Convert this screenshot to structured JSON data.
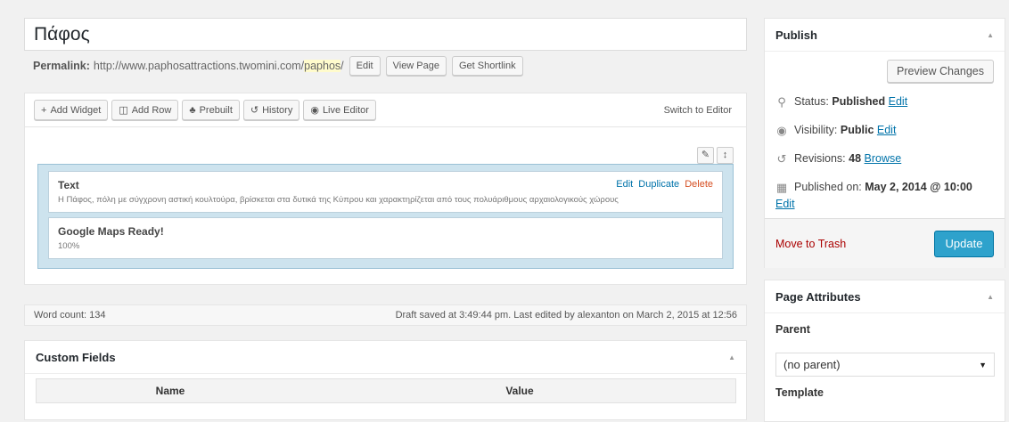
{
  "title": "Πάφος",
  "permalink": {
    "label": "Permalink:",
    "base": "http://www.paphosattractions.twomini.com/",
    "slug": "paphos",
    "slash": "/",
    "edit": "Edit",
    "view": "View Page",
    "shortlink": "Get Shortlink"
  },
  "builder": {
    "add_widget": "Add Widget",
    "add_row": "Add Row",
    "prebuilt": "Prebuilt",
    "history": "History",
    "live_editor": "Live Editor",
    "switch": "Switch to Editor",
    "widgets": [
      {
        "title": "Text",
        "desc": "Η Πάφος, πόλη με σύγχρονη αστική κουλτούρα, βρίσκεται στα δυτικά της Κύπρου και χαρακτηρίζεται από τους πολυάριθμους αρχαιολογικούς χώρους",
        "edit": "Edit",
        "duplicate": "Duplicate",
        "delete": "Delete"
      },
      {
        "title": "Google Maps Ready!",
        "desc": "100%"
      }
    ]
  },
  "status": {
    "word_count": "Word count: 134",
    "draft": "Draft saved at 3:49:44 pm. Last edited by alexanton on March 2, 2015 at 12:56"
  },
  "custom_fields": {
    "title": "Custom Fields",
    "col_name": "Name",
    "col_value": "Value"
  },
  "publish": {
    "title": "Publish",
    "preview": "Preview Changes",
    "status_label": "Status:",
    "status_value": "Published",
    "visibility_label": "Visibility:",
    "visibility_value": "Public",
    "revisions_label": "Revisions:",
    "revisions_value": "48",
    "browse": "Browse",
    "published_label": "Published on:",
    "published_value": "May 2, 2014 @ 10:00",
    "edit": "Edit",
    "trash": "Move to Trash",
    "update": "Update"
  },
  "page_attributes": {
    "title": "Page Attributes",
    "parent_label": "Parent",
    "parent_value": "(no parent)",
    "template_label": "Template"
  }
}
